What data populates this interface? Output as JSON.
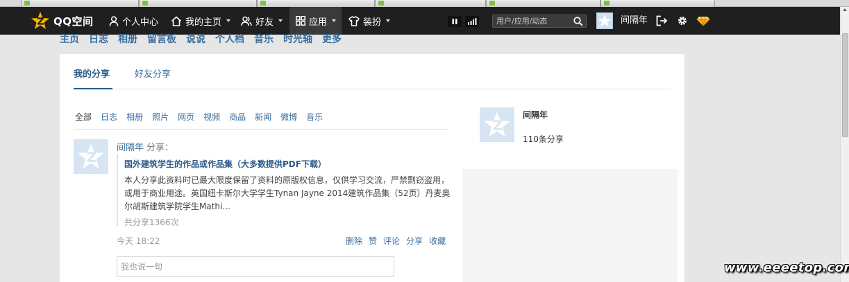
{
  "colors": {
    "topbar_bg": "#1f1f1f",
    "link_blue": "#3a6e9e",
    "title_blue": "#2b5b8a",
    "page_bg": "#e6e6e6",
    "logo_yellow": "#f7b500"
  },
  "topbar": {
    "logo_icon": "qzone-star-icon",
    "logo_text": "QQ空间",
    "items": [
      {
        "label": "个人中心",
        "icon": "user-icon"
      },
      {
        "label": "我的主页",
        "icon": "home-icon"
      },
      {
        "label": "好友",
        "icon": "friends-icon"
      },
      {
        "label": "应用",
        "icon": "apps-grid-icon"
      },
      {
        "label": "装扮",
        "icon": "shirt-icon"
      }
    ],
    "search_placeholder": "用户/应用/动态",
    "user_name": "间隔年"
  },
  "subnav": {
    "items": [
      "主页",
      "日志",
      "相册",
      "留言板",
      "说说",
      "个人档",
      "音乐",
      "时光轴",
      "更多"
    ]
  },
  "share_tabs": {
    "mine": "我的分享",
    "friends": "好友分享"
  },
  "filters": [
    "全部",
    "日志",
    "相册",
    "照片",
    "网页",
    "视频",
    "商品",
    "新闻",
    "微博",
    "音乐"
  ],
  "post": {
    "author": "间隔年",
    "verb": "分享：",
    "title": "国外建筑学生的作品或作品集（大多数提供PDF下载）",
    "description": "本人分享此资料时已最大限度保留了资料的原版权信息，仅供学习交流，严禁剽窃盗用，或用于商业用途。英国纽卡斯尔大学学生Tynan Jayne 2014建筑作品集（52页）丹麦奥尔胡斯建筑学院学生Mathi...",
    "share_count": "共分享1366次",
    "time": "今天 18:22",
    "actions": [
      "删除",
      "赞",
      "评论",
      "分享",
      "收藏"
    ],
    "comment_placeholder": "我也说一句"
  },
  "profile": {
    "name": "间隔年",
    "share_count": "110条分享"
  },
  "watermark": "www.eeeetop.com"
}
